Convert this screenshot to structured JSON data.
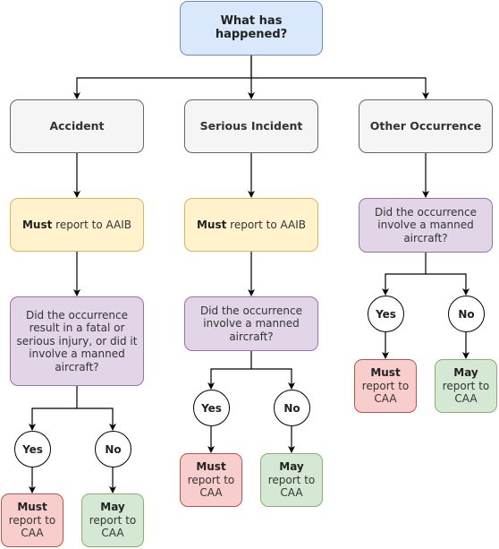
{
  "root": {
    "label": "What has happened?"
  },
  "categories": [
    {
      "label": "Accident"
    },
    {
      "label": "Serious Incident"
    },
    {
      "label": "Other Occurrence"
    }
  ],
  "aaib": [
    {
      "bold": "Must",
      "rest": " report to AAIB"
    },
    {
      "bold": "Must",
      "rest": " report to AAIB"
    }
  ],
  "questions": [
    {
      "text": "Did the occurrence result in a fatal or serious injury, or did it involve a manned aircraft?"
    },
    {
      "text": "Did the occurrence involve a manned aircraft?"
    },
    {
      "text": "Did the occurrence involve a manned aircraft?"
    }
  ],
  "answers": {
    "yes": "Yes",
    "no": "No"
  },
  "outcomes": {
    "must": {
      "bold": "Must",
      "rest": " report to CAA"
    },
    "may": {
      "bold": "May",
      "rest": " report to CAA"
    }
  },
  "colors": {
    "root_fill": "#dae8fc",
    "category_fill": "#f5f5f5",
    "aaib_fill": "#fff2cc",
    "question_fill": "#e1d5e7",
    "must_fill": "#f8cecc",
    "may_fill": "#d5e8d4"
  }
}
